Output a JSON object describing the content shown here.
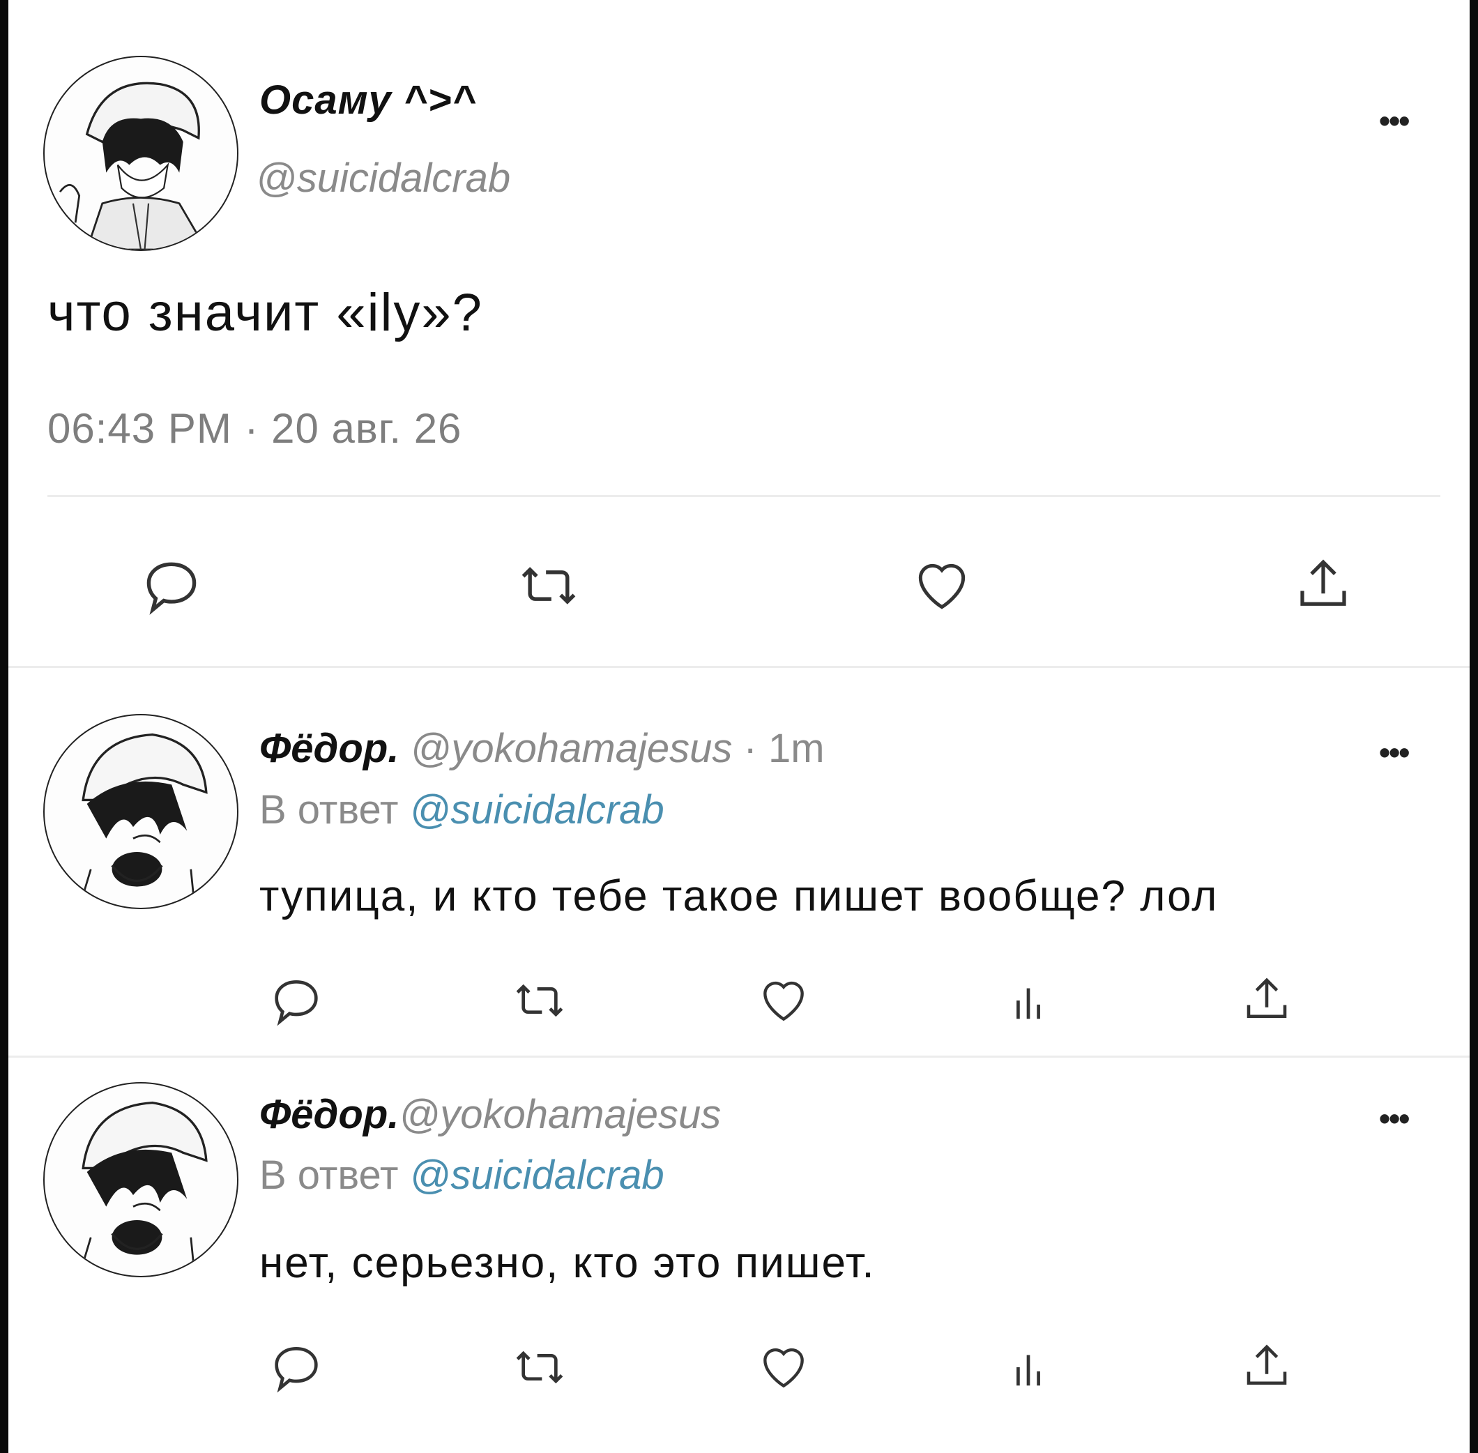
{
  "main_tweet": {
    "display_name": "Осаму ^>^",
    "handle": "@suicidalcrab",
    "text": "что значит «ily»?",
    "meta": "06:43 PM · 20 авг. 26"
  },
  "replies": [
    {
      "display_name": "Фёдор.",
      "handle": "@yokohamajesus",
      "time": "· 1m",
      "reply_prefix": "В ответ",
      "reply_mention": "@suicidalcrab",
      "text": "тупица, и кто тебе такое пишет вообще? лол"
    },
    {
      "display_name": "Фёдор.",
      "handle": "@yokohamajesus",
      "time": "",
      "reply_prefix": "В ответ",
      "reply_mention": "@suicidalcrab",
      "text": "нет, серьезно, кто это пишет."
    }
  ],
  "more_glyph": "•••",
  "icons": [
    "reply-icon",
    "retweet-icon",
    "like-icon",
    "views-icon",
    "share-icon"
  ],
  "colors": {
    "mention": "#4a8fb0",
    "muted": "#8a8a8a",
    "text": "#111111"
  }
}
